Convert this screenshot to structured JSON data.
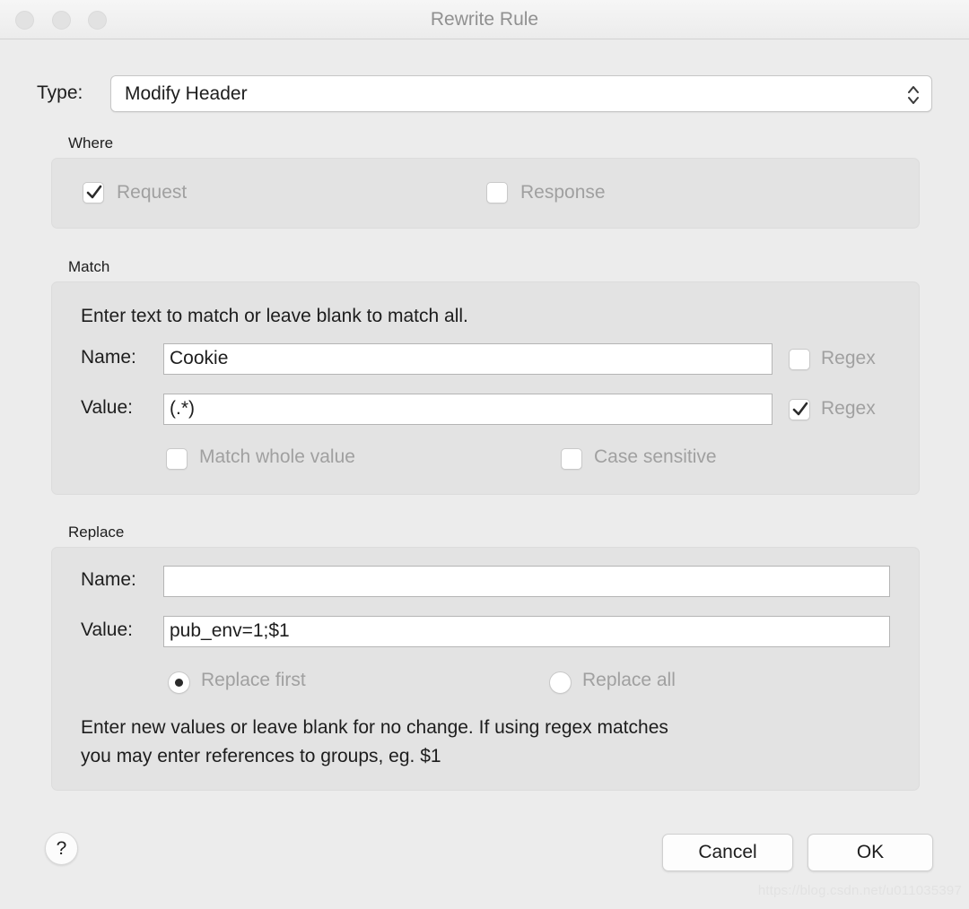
{
  "window": {
    "title": "Rewrite Rule",
    "traffic_lights": [
      "close",
      "minimize",
      "zoom"
    ]
  },
  "type_row": {
    "label": "Type:",
    "selected_option": "Modify Header",
    "stepper_icon": "chevron-up-down-icon"
  },
  "where_section": {
    "label": "Where",
    "options": [
      {
        "label": "Request",
        "checked": true,
        "enabled": false
      },
      {
        "label": "Response",
        "checked": false,
        "enabled": false
      }
    ]
  },
  "match_section": {
    "label": "Match",
    "hint": "Enter text to match or leave blank to match all.",
    "name_label": "Name:",
    "name_value": "Cookie",
    "name_regex_label": "Regex",
    "name_regex_checked": false,
    "value_label": "Value:",
    "value_value": "(.*)",
    "value_regex_label": "Regex",
    "value_regex_checked": true,
    "match_whole_value_label": "Match whole value",
    "match_whole_value_checked": false,
    "case_sensitive_label": "Case sensitive",
    "case_sensitive_checked": false
  },
  "replace_section": {
    "label": "Replace",
    "name_label": "Name:",
    "name_value": "",
    "value_label": "Value:",
    "value_value": "pub_env=1;$1",
    "replace_first_label": "Replace first",
    "replace_first_selected": true,
    "replace_all_label": "Replace all",
    "replace_all_selected": false,
    "hint_line1": "Enter new values or leave blank for no change. If using regex matches",
    "hint_line2": "you may enter references to groups, eg. $1"
  },
  "footer": {
    "help_label": "?",
    "cancel_label": "Cancel",
    "ok_label": "OK"
  },
  "watermark": {
    "text": "https://blog.csdn.net/u011035397"
  },
  "colors": {
    "window_background": "#ececec",
    "group_background": "#e3e3e3",
    "title_text": "#909090",
    "body_text": "#1d1d1d",
    "disabled_text": "#a0a0a0",
    "field_border": "#b5b5b5"
  }
}
